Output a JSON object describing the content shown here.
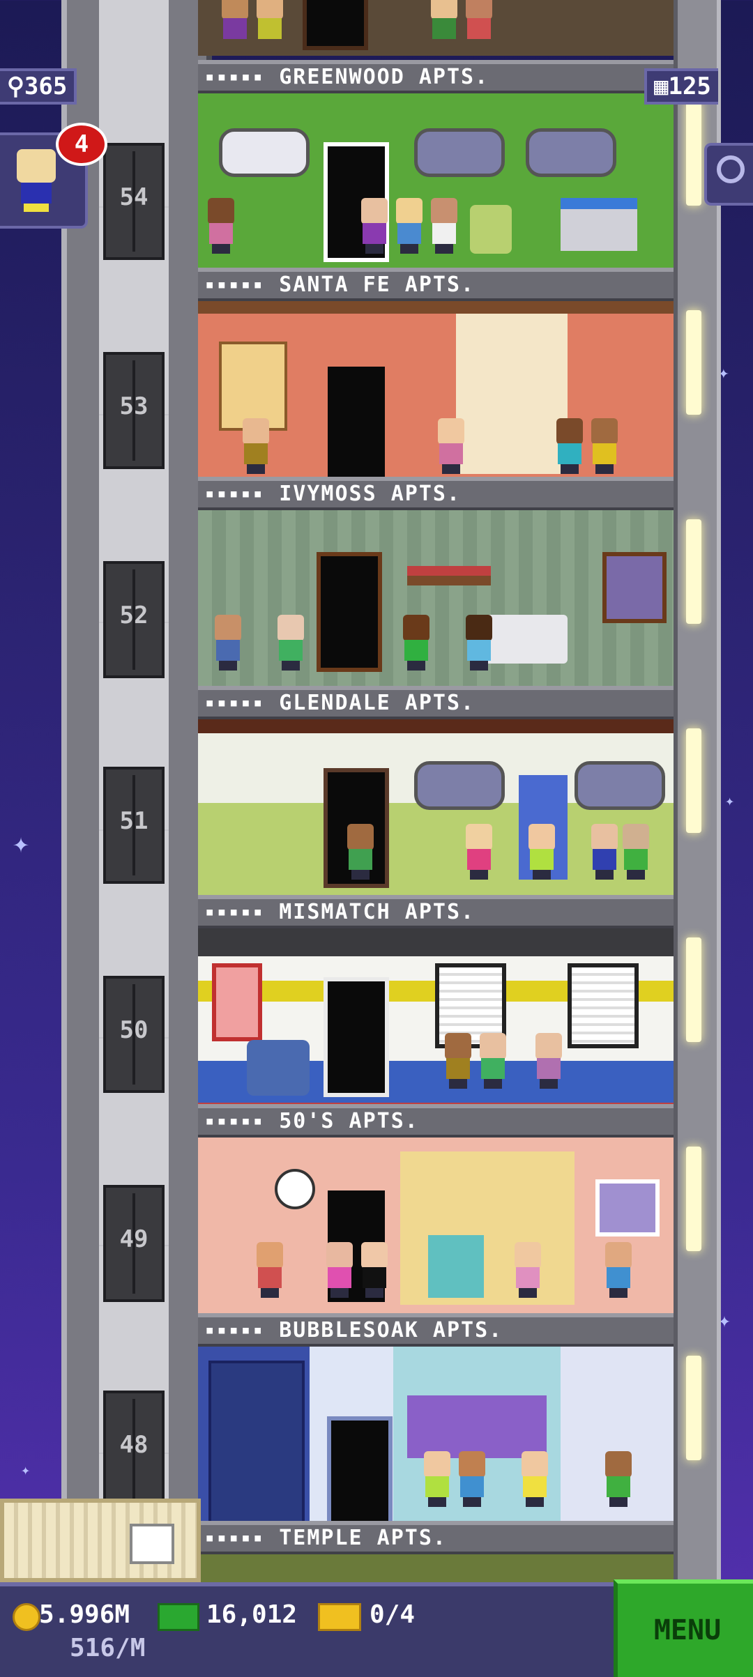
{
  "hud": {
    "population": "365",
    "floors": "125",
    "notification_count": "4",
    "coins": "5.996M",
    "coins_rate": "516/M",
    "bux": "16,012",
    "tickets": "0/4",
    "menu_label": "MENU"
  },
  "elevator_floors": [
    "54",
    "53",
    "52",
    "51",
    "50",
    "49",
    "48"
  ],
  "floor_banners": [
    "GREENWOOD APTS.",
    "SANTA FE APTS.",
    "IVYMOSS APTS.",
    "GLENDALE APTS.",
    "MISMATCH APTS.",
    "50'S APTS.",
    "BUBBLESOAK APTS.",
    "TEMPLE APTS."
  ],
  "banner_dots": "▪▪▪▪▪",
  "colors": {
    "greenwood_wall": "#5aa83a",
    "santafe_wall": "#e07d63",
    "ivymoss_wall": "#8aa38a",
    "glendale_wall": "#eef0e6",
    "mismatch_wall": "#f4f4f0",
    "fifties_wall": "#f0b8a8",
    "bubblesoak_wall": "#3a4fa8",
    "menu_green": "#2ea82a"
  }
}
